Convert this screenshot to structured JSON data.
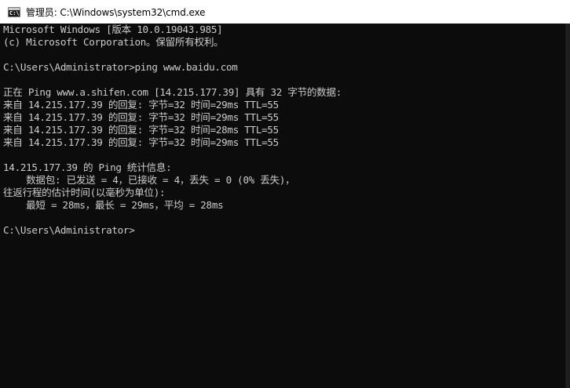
{
  "window": {
    "title": "管理员: C:\\Windows\\system32\\cmd.exe",
    "icon": "cmd-icon",
    "icon_glyph": "C:\\"
  },
  "console": {
    "lines": [
      "Microsoft Windows [版本 10.0.19043.985]",
      "(c) Microsoft Corporation。保留所有权利。",
      "",
      "C:\\Users\\Administrator>ping www.baidu.com",
      "",
      "正在 Ping www.a.shifen.com [14.215.177.39] 具有 32 字节的数据:",
      "来自 14.215.177.39 的回复: 字节=32 时间=29ms TTL=55",
      "来自 14.215.177.39 的回复: 字节=32 时间=29ms TTL=55",
      "来自 14.215.177.39 的回复: 字节=32 时间=28ms TTL=55",
      "来自 14.215.177.39 的回复: 字节=32 时间=29ms TTL=55",
      "",
      "14.215.177.39 的 Ping 统计信息:",
      "    数据包: 已发送 = 4，已接收 = 4，丢失 = 0 (0% 丢失)，",
      "往返行程的估计时间(以毫秒为单位):",
      "    最短 = 28ms，最长 = 29ms，平均 = 28ms",
      "",
      "C:\\Users\\Administrator>"
    ]
  },
  "colors": {
    "background": "#0c0c0c",
    "text": "#cccccc",
    "titlebar": "#ffffff"
  }
}
